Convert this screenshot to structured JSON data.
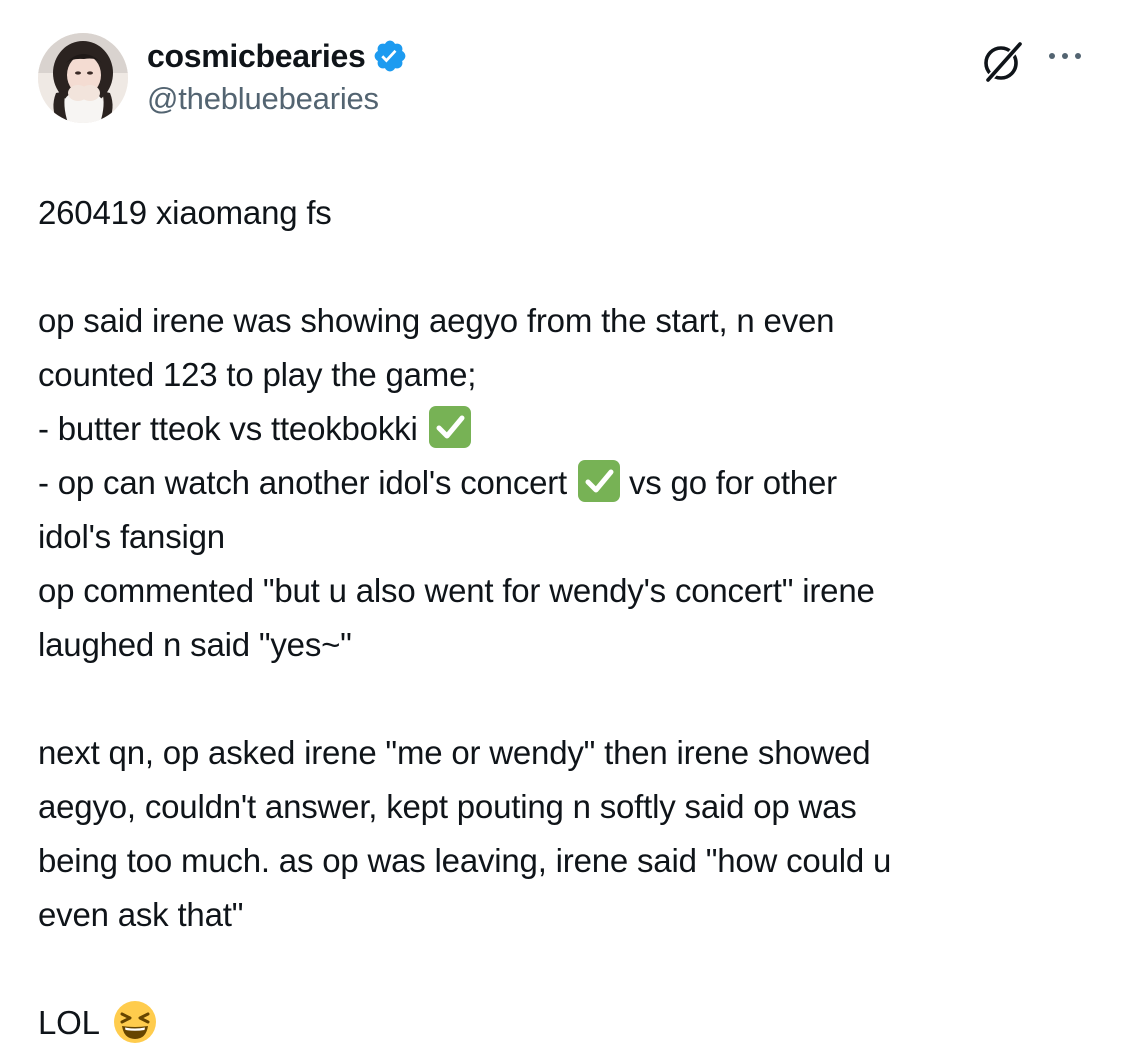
{
  "author": {
    "display_name": "cosmicbearies",
    "handle": "@thebluebearies",
    "verified": true,
    "verified_color": "#1d9bf0"
  },
  "icons": {
    "grok": "grok-icon",
    "more": "more-dots-icon",
    "verified": "verified-badge-icon",
    "check": "white-check-mark-emoji",
    "laugh": "grinning-squinting-face-emoji"
  },
  "post": {
    "lines": {
      "l1": "260419 xiaomang fs",
      "l2": "op said irene was showing aegyo from the start, n even",
      "l3": "counted 123 to play the game;",
      "l4": "- butter tteok vs tteokbokki",
      "l5_a": "- op can watch another idol's concert",
      "l5_b": "vs go for other",
      "l6": "idol's fansign",
      "l7": "op commented \"but u also went for wendy's concert\" irene",
      "l8": "laughed n said \"yes~\"",
      "l9": "next qn, op asked irene \"me or wendy\" then irene showed",
      "l10": "aegyo, couldn't answer, kept pouting n softly said op was",
      "l11": "being too much. as op was leaving, irene said \"how could u",
      "l12": "even ask that\"",
      "l13": "LOL"
    }
  },
  "colors": {
    "text": "#0f1419",
    "secondary": "#536471",
    "check_green": "#77b255",
    "emoji_yellow": "#ffcc4d"
  }
}
